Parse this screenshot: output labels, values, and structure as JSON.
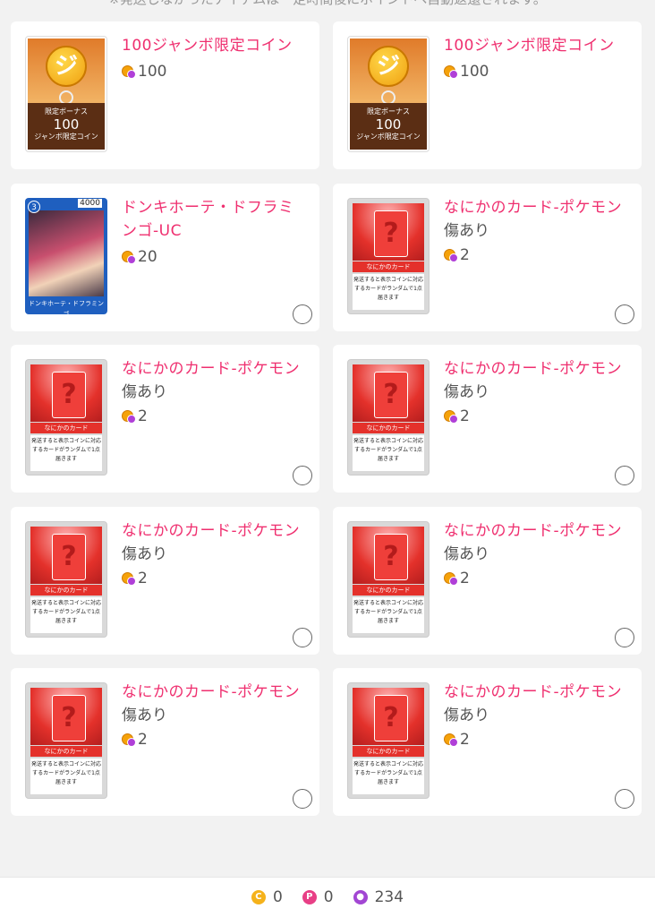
{
  "top_note": "※発送しなかったアイテムは一定時間後にポイントへ自動返還されます。",
  "cards": [
    {
      "name": "100ジャンボ限定コイン",
      "condition": "",
      "price": "100",
      "thumb": "jumbo",
      "thumb_b1": "限定ボーナス",
      "thumb_b2": "100",
      "thumb_b3": "ジャンボ限定コイン",
      "selectable": false
    },
    {
      "name": "100ジャンボ限定コイン",
      "condition": "",
      "price": "100",
      "thumb": "jumbo",
      "thumb_b1": "限定ボーナス",
      "thumb_b2": "100",
      "thumb_b3": "ジャンボ限定コイン",
      "selectable": false
    },
    {
      "name": "ドンキホーテ・ドフラミンゴ-UC",
      "condition": "",
      "price": "20",
      "thumb": "onepiece",
      "thumb_cost": "3",
      "thumb_power": "4000",
      "thumb_title": "ドンキホーテ・ドフラミンゴ",
      "selectable": true
    },
    {
      "name": "なにかのカード-ポケモン",
      "condition": "傷あり",
      "price": "2",
      "thumb": "mystery",
      "thumb_label": "なにかのカード",
      "thumb_text": "発送すると表示コインに対応するカードがランダムで1点届きます",
      "selectable": true
    },
    {
      "name": "なにかのカード-ポケモン",
      "condition": "傷あり",
      "price": "2",
      "thumb": "mystery",
      "thumb_label": "なにかのカード",
      "thumb_text": "発送すると表示コインに対応するカードがランダムで1点届きます",
      "selectable": true
    },
    {
      "name": "なにかのカード-ポケモン",
      "condition": "傷あり",
      "price": "2",
      "thumb": "mystery",
      "thumb_label": "なにかのカード",
      "thumb_text": "発送すると表示コインに対応するカードがランダムで1点届きます",
      "selectable": true
    },
    {
      "name": "なにかのカード-ポケモン",
      "condition": "傷あり",
      "price": "2",
      "thumb": "mystery",
      "thumb_label": "なにかのカード",
      "thumb_text": "発送すると表示コインに対応するカードがランダムで1点届きます",
      "selectable": true
    },
    {
      "name": "なにかのカード-ポケモン",
      "condition": "傷あり",
      "price": "2",
      "thumb": "mystery",
      "thumb_label": "なにかのカード",
      "thumb_text": "発送すると表示コインに対応するカードがランダムで1点届きます",
      "selectable": true
    },
    {
      "name": "なにかのカード-ポケモン",
      "condition": "傷あり",
      "price": "2",
      "thumb": "mystery",
      "thumb_label": "なにかのカード",
      "thumb_text": "発送すると表示コインに対応するカードがランダムで1点届きます",
      "selectable": true
    },
    {
      "name": "なにかのカード-ポケモン",
      "condition": "傷あり",
      "price": "2",
      "thumb": "mystery",
      "thumb_label": "なにかのカード",
      "thumb_text": "発送すると表示コインに対応するカードがランダムで1点届きます",
      "selectable": true
    }
  ],
  "footer": {
    "coin_icon_text": "C",
    "coin_value": "0",
    "point_icon_text": "P",
    "point_value": "0",
    "gem_value": "234",
    "colors": {
      "coin": "#f5b21b",
      "point": "#e83f86",
      "gem": "#a246d3"
    }
  }
}
